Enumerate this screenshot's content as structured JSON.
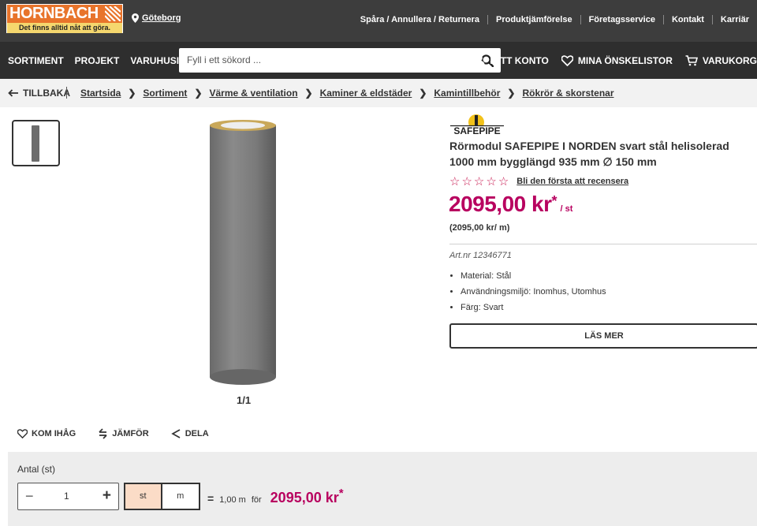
{
  "header": {
    "logo_name": "HORNBACH",
    "logo_tagline": "Det finns alltid nåt att göra.",
    "location": "Göteborg",
    "links": [
      "Spåra / Annullera / Returnera",
      "Produktjämförelse",
      "Företagsservice",
      "Kontakt",
      "Karriär"
    ]
  },
  "nav": {
    "items": [
      "SORTIMENT",
      "PROJEKT",
      "VARUHUSINFO"
    ],
    "search_placeholder": "Fyll i ett sökord ...",
    "right": {
      "account": "MITT KONTO",
      "wishlist": "MINA ÖNSKELISTOR",
      "cart": "VARUKORG"
    }
  },
  "breadcrumb": {
    "back": "TILLBAKA",
    "items": [
      "Startsida",
      "Sortiment",
      "Värme & ventilation",
      "Kaminer & eldstäder",
      "Kamintillbehör",
      "Rökrör & skorstenar"
    ]
  },
  "product": {
    "brand": "SAFEPIPE",
    "title": "Rörmodul SAFEPIPE I NORDEN svart stål helisolerad 1000 mm bygglängd 935 mm ∅ 150 mm",
    "rating_stars": 0,
    "review_link": "Bli den första att recensera",
    "price": "2095,00 kr",
    "price_asterisk": "*",
    "price_unit": "/ st",
    "price_per_m": "(2095,00 kr/ m)",
    "article_number": "Art.nr 12346771",
    "attributes": [
      "Material: Stål",
      "Användningsmiljö: Inomhus, Utomhus",
      "Färg: Svart"
    ],
    "read_more": "LÄS MER",
    "image_counter": "1/1"
  },
  "actions": {
    "remember": "KOM IHÅG",
    "compare": "JÄMFÖR",
    "share": "DELA"
  },
  "quantity": {
    "label": "Antal (st)",
    "value": "1",
    "unit_st": "st",
    "unit_m": "m",
    "equals": "=",
    "length": "1,00 m",
    "for": "för",
    "total": "2095,00 kr",
    "total_asterisk": "*"
  },
  "colors": {
    "price": "#b8005f",
    "topbar": "#3d3d3d",
    "navbar": "#2e2e2e",
    "logo_orange": "#e8742b",
    "active_unit": "#fbdcc7"
  }
}
